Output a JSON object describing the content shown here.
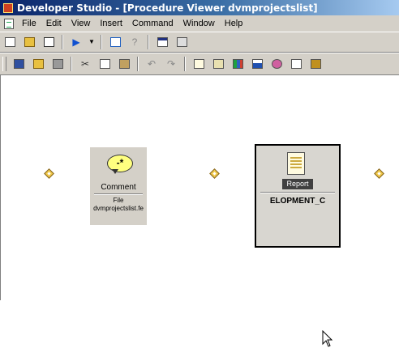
{
  "window": {
    "title": "Developer Studio - [Procedure Viewer dvmprojectslist]"
  },
  "menubar": {
    "items": [
      {
        "label": "File"
      },
      {
        "label": "Edit"
      },
      {
        "label": "View"
      },
      {
        "label": "Insert"
      },
      {
        "label": "Command"
      },
      {
        "label": "Window"
      },
      {
        "label": "Help"
      }
    ]
  },
  "toolbar1": {
    "icons": [
      "new-document-icon",
      "open-folder-icon",
      "properties-icon",
      "run-icon",
      "dropdown-arrow-icon",
      "procedure-icon",
      "help-icon",
      "window-icon",
      "grid-icon"
    ]
  },
  "toolbar2": {
    "icons": [
      "save-icon",
      "open-icon",
      "print-icon",
      "cut-icon",
      "copy-icon",
      "paste-icon",
      "undo-icon",
      "redo-icon",
      "report-icon",
      "define-icon",
      "chart-icon",
      "graph-icon",
      "map-icon",
      "text-icon",
      "more-icon"
    ]
  },
  "canvas": {
    "comment_node": {
      "bubble_text": "-*",
      "title": "Comment",
      "sub_line1": "File",
      "sub_line2": "dvmprojectslist.fe"
    },
    "report_node": {
      "tag": "Report",
      "name": "ELOPMENT_C"
    }
  },
  "colors": {
    "title_start": "#0a246a",
    "title_end": "#a6caf0",
    "chrome": "#d4d0c8",
    "diamond": "#f0c848"
  }
}
